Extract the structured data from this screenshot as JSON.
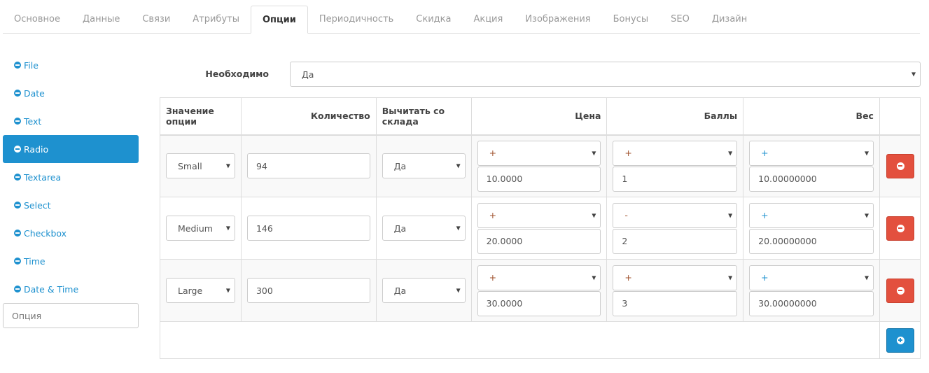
{
  "tabs": [
    "Основное",
    "Данные",
    "Связи",
    "Атрибуты",
    "Опции",
    "Периодичность",
    "Скидка",
    "Акция",
    "Изображения",
    "Бонусы",
    "SEO",
    "Дизайн"
  ],
  "active_tab": "Опции",
  "sidebar": {
    "items": [
      "File",
      "Date",
      "Text",
      "Radio",
      "Textarea",
      "Select",
      "Checkbox",
      "Time",
      "Date & Time"
    ],
    "active": "Radio",
    "option_placeholder": "Опция"
  },
  "required": {
    "label": "Необходимо",
    "value": "Да"
  },
  "table": {
    "headers": [
      "Значение опции",
      "Количество",
      "Вычитать со склада",
      "Цена",
      "Баллы",
      "Вес"
    ],
    "rows": [
      {
        "value": "Small",
        "qty": "94",
        "subtract": "Да",
        "price_prefix": "+",
        "price": "10.0000",
        "points_prefix": "+",
        "points": "1",
        "weight_prefix": "+",
        "weight": "10.00000000"
      },
      {
        "value": "Medium",
        "qty": "146",
        "subtract": "Да",
        "price_prefix": "+",
        "price": "20.0000",
        "points_prefix": "-",
        "points": "2",
        "weight_prefix": "+",
        "weight": "20.00000000"
      },
      {
        "value": "Large",
        "qty": "300",
        "subtract": "Да",
        "price_prefix": "+",
        "price": "30.0000",
        "points_prefix": "+",
        "points": "3",
        "weight_prefix": "+",
        "weight": "30.00000000"
      }
    ]
  },
  "colors": {
    "accent": "#1e91cf",
    "danger": "#e3503e"
  }
}
